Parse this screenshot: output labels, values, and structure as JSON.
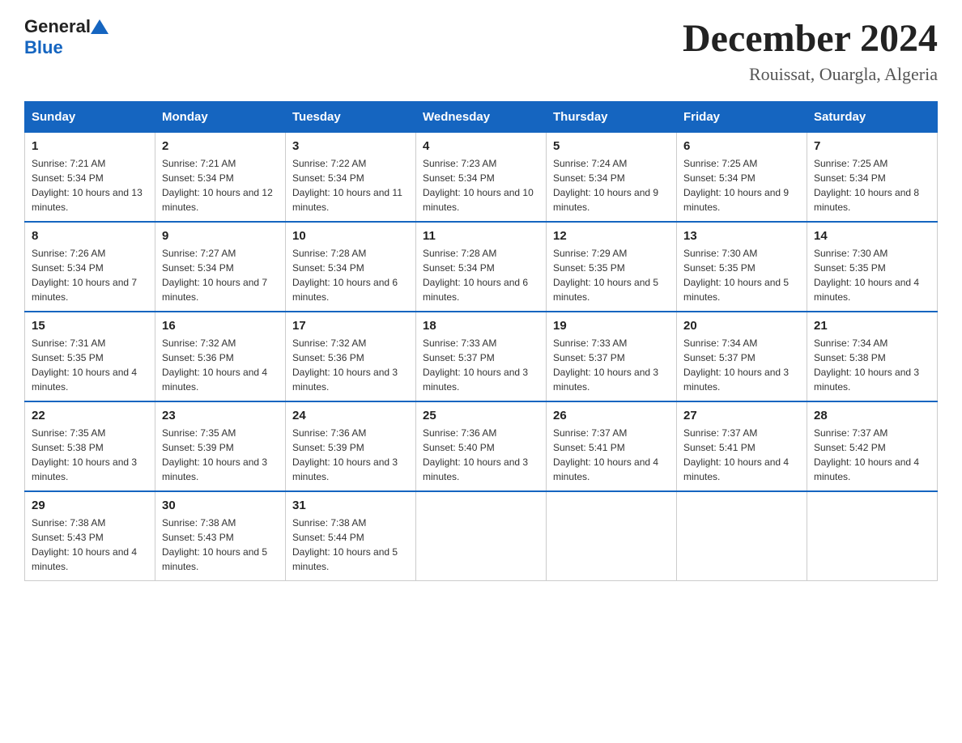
{
  "logo": {
    "general_text": "General",
    "blue_text": "Blue"
  },
  "title": {
    "month_year": "December 2024",
    "location": "Rouissat, Ouargla, Algeria"
  },
  "headers": [
    "Sunday",
    "Monday",
    "Tuesday",
    "Wednesday",
    "Thursday",
    "Friday",
    "Saturday"
  ],
  "weeks": [
    [
      {
        "day": "1",
        "sunrise": "7:21 AM",
        "sunset": "5:34 PM",
        "daylight": "10 hours and 13 minutes."
      },
      {
        "day": "2",
        "sunrise": "7:21 AM",
        "sunset": "5:34 PM",
        "daylight": "10 hours and 12 minutes."
      },
      {
        "day": "3",
        "sunrise": "7:22 AM",
        "sunset": "5:34 PM",
        "daylight": "10 hours and 11 minutes."
      },
      {
        "day": "4",
        "sunrise": "7:23 AM",
        "sunset": "5:34 PM",
        "daylight": "10 hours and 10 minutes."
      },
      {
        "day": "5",
        "sunrise": "7:24 AM",
        "sunset": "5:34 PM",
        "daylight": "10 hours and 9 minutes."
      },
      {
        "day": "6",
        "sunrise": "7:25 AM",
        "sunset": "5:34 PM",
        "daylight": "10 hours and 9 minutes."
      },
      {
        "day": "7",
        "sunrise": "7:25 AM",
        "sunset": "5:34 PM",
        "daylight": "10 hours and 8 minutes."
      }
    ],
    [
      {
        "day": "8",
        "sunrise": "7:26 AM",
        "sunset": "5:34 PM",
        "daylight": "10 hours and 7 minutes."
      },
      {
        "day": "9",
        "sunrise": "7:27 AM",
        "sunset": "5:34 PM",
        "daylight": "10 hours and 7 minutes."
      },
      {
        "day": "10",
        "sunrise": "7:28 AM",
        "sunset": "5:34 PM",
        "daylight": "10 hours and 6 minutes."
      },
      {
        "day": "11",
        "sunrise": "7:28 AM",
        "sunset": "5:34 PM",
        "daylight": "10 hours and 6 minutes."
      },
      {
        "day": "12",
        "sunrise": "7:29 AM",
        "sunset": "5:35 PM",
        "daylight": "10 hours and 5 minutes."
      },
      {
        "day": "13",
        "sunrise": "7:30 AM",
        "sunset": "5:35 PM",
        "daylight": "10 hours and 5 minutes."
      },
      {
        "day": "14",
        "sunrise": "7:30 AM",
        "sunset": "5:35 PM",
        "daylight": "10 hours and 4 minutes."
      }
    ],
    [
      {
        "day": "15",
        "sunrise": "7:31 AM",
        "sunset": "5:35 PM",
        "daylight": "10 hours and 4 minutes."
      },
      {
        "day": "16",
        "sunrise": "7:32 AM",
        "sunset": "5:36 PM",
        "daylight": "10 hours and 4 minutes."
      },
      {
        "day": "17",
        "sunrise": "7:32 AM",
        "sunset": "5:36 PM",
        "daylight": "10 hours and 3 minutes."
      },
      {
        "day": "18",
        "sunrise": "7:33 AM",
        "sunset": "5:37 PM",
        "daylight": "10 hours and 3 minutes."
      },
      {
        "day": "19",
        "sunrise": "7:33 AM",
        "sunset": "5:37 PM",
        "daylight": "10 hours and 3 minutes."
      },
      {
        "day": "20",
        "sunrise": "7:34 AM",
        "sunset": "5:37 PM",
        "daylight": "10 hours and 3 minutes."
      },
      {
        "day": "21",
        "sunrise": "7:34 AM",
        "sunset": "5:38 PM",
        "daylight": "10 hours and 3 minutes."
      }
    ],
    [
      {
        "day": "22",
        "sunrise": "7:35 AM",
        "sunset": "5:38 PM",
        "daylight": "10 hours and 3 minutes."
      },
      {
        "day": "23",
        "sunrise": "7:35 AM",
        "sunset": "5:39 PM",
        "daylight": "10 hours and 3 minutes."
      },
      {
        "day": "24",
        "sunrise": "7:36 AM",
        "sunset": "5:39 PM",
        "daylight": "10 hours and 3 minutes."
      },
      {
        "day": "25",
        "sunrise": "7:36 AM",
        "sunset": "5:40 PM",
        "daylight": "10 hours and 3 minutes."
      },
      {
        "day": "26",
        "sunrise": "7:37 AM",
        "sunset": "5:41 PM",
        "daylight": "10 hours and 4 minutes."
      },
      {
        "day": "27",
        "sunrise": "7:37 AM",
        "sunset": "5:41 PM",
        "daylight": "10 hours and 4 minutes."
      },
      {
        "day": "28",
        "sunrise": "7:37 AM",
        "sunset": "5:42 PM",
        "daylight": "10 hours and 4 minutes."
      }
    ],
    [
      {
        "day": "29",
        "sunrise": "7:38 AM",
        "sunset": "5:43 PM",
        "daylight": "10 hours and 4 minutes."
      },
      {
        "day": "30",
        "sunrise": "7:38 AM",
        "sunset": "5:43 PM",
        "daylight": "10 hours and 5 minutes."
      },
      {
        "day": "31",
        "sunrise": "7:38 AM",
        "sunset": "5:44 PM",
        "daylight": "10 hours and 5 minutes."
      },
      null,
      null,
      null,
      null
    ]
  ]
}
